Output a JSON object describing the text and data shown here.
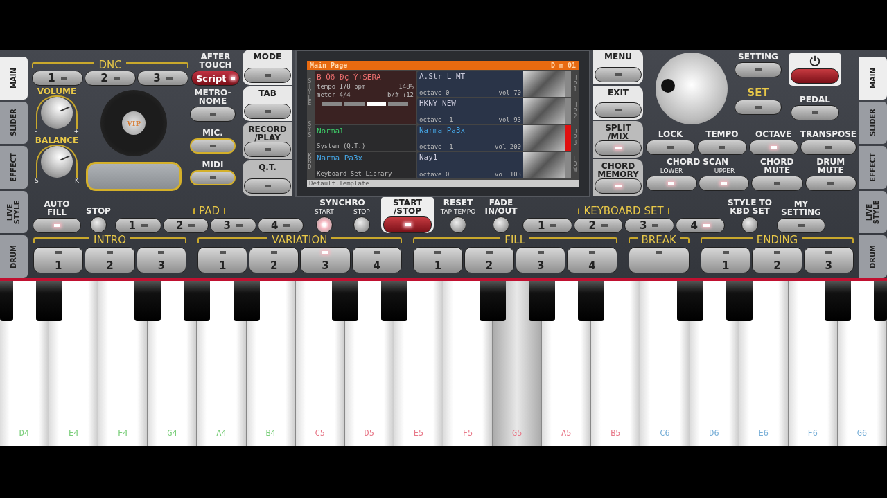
{
  "side_tabs_left": [
    {
      "label": "MAIN",
      "selected": true
    },
    {
      "label": "SLIDER",
      "selected": false
    },
    {
      "label": "EFFECT",
      "selected": false
    },
    {
      "label": "LIVE\nSTYLE",
      "selected": false
    },
    {
      "label": "DRUM",
      "selected": false
    }
  ],
  "side_tabs_right": [
    {
      "label": "MAIN",
      "selected": true
    },
    {
      "label": "SLIDER",
      "selected": false
    },
    {
      "label": "EFFECT",
      "selected": false
    },
    {
      "label": "LIVE\nSTYLE",
      "selected": false
    },
    {
      "label": "DRUM",
      "selected": false
    }
  ],
  "dnc": {
    "title": "DNC",
    "buttons": [
      {
        "label": "1",
        "lit": false
      },
      {
        "label": "2",
        "lit": false
      },
      {
        "label": "3",
        "lit": false
      }
    ]
  },
  "after_touch": {
    "label": "AFTER\nTOUCH",
    "button": {
      "label": "Script",
      "lit": true
    }
  },
  "volume": {
    "label": "VOLUME",
    "min_mark": "-",
    "max_mark": "+"
  },
  "balance": {
    "label": "BALANCE",
    "min_mark": "S",
    "max_mark": "K"
  },
  "vip_disc": {
    "label": "VIP"
  },
  "side_buttons": [
    {
      "label": "METRO-\nNOME",
      "lit": false,
      "framed": false
    },
    {
      "label": "MIC.",
      "lit": false,
      "framed": true
    },
    {
      "label": "MIDI",
      "lit": false,
      "framed": true
    }
  ],
  "mode_buttons": [
    {
      "label": "MODE",
      "lit": false
    },
    {
      "label": "TAB",
      "lit": false
    },
    {
      "label": "RECORD\n/PLAY",
      "lit": false
    },
    {
      "label": "Q.T.",
      "lit": false
    }
  ],
  "display": {
    "title": "Main Page",
    "code": "D m 01",
    "style_tag": "STYLE",
    "sys_tag": "SYS",
    "kbd_tag": "KBD",
    "style_name": "B Ôö Ðç Ý+SERA",
    "tempo": "tempo 178 bpm",
    "tempo_pct": "148%",
    "meter": "meter 4/4",
    "transpose": "b/# +12",
    "bars": [
      {
        "selected": false
      },
      {
        "selected": false
      },
      {
        "selected": true
      },
      {
        "selected": false
      }
    ],
    "sys_name": "Normal",
    "sys_sub": "System (Q.T.)",
    "kbd_name": "Narma Pa3x",
    "kbd_sub": "Keyboard Set Library",
    "footer": "Default.Template",
    "voices": [
      {
        "name": "A.Str L MT",
        "octave": "octave 0",
        "vol": "vol 70",
        "tag": "UP1",
        "selected": false
      },
      {
        "name": "HKNY NEW",
        "octave": "octave -1",
        "vol": "vol 93",
        "tag": "UP2",
        "selected": false
      },
      {
        "name": "Narma Pa3x",
        "octave": "octave -1",
        "vol": "vol 200",
        "tag": "UP3",
        "selected": true
      },
      {
        "name": "Nay1",
        "octave": "octave 0",
        "vol": "vol 103",
        "tag": "LOW",
        "selected": false
      }
    ]
  },
  "right_col_buttons": [
    {
      "label": "MENU",
      "lit": false
    },
    {
      "label": "EXIT",
      "lit": false
    },
    {
      "label": "SPLIT\n/MIX",
      "lit": true
    },
    {
      "label": "CHORD\nMEMORY",
      "lit": true
    }
  ],
  "setting": {
    "label": "SETTING",
    "lit": false
  },
  "set": {
    "label": "SET",
    "lit": false
  },
  "power": {
    "lit": true
  },
  "pedal": {
    "label": "PEDAL",
    "lit": false
  },
  "control_row": [
    {
      "label": "LOCK",
      "lit": false
    },
    {
      "label": "TEMPO",
      "lit": false
    },
    {
      "label": "OCTAVE",
      "lit": true
    },
    {
      "label": "TRANSPOSE",
      "lit": false
    }
  ],
  "chord_scan": {
    "label": "CHORD SCAN",
    "lower": {
      "label": "LOWER",
      "lit": true
    },
    "upper": {
      "label": "UPPER",
      "lit": true
    }
  },
  "mute_buttons": [
    {
      "label": "CHORD\nMUTE",
      "lit": false
    },
    {
      "label": "DRUM\nMUTE",
      "lit": false
    }
  ],
  "auto_fill": {
    "label": "AUTO\nFILL",
    "lit": true
  },
  "pad": {
    "stop": "STOP",
    "title": "PAD",
    "buttons": [
      {
        "label": "1",
        "lit": false
      },
      {
        "label": "2",
        "lit": false
      },
      {
        "label": "3",
        "lit": false
      },
      {
        "label": "4",
        "lit": false
      }
    ]
  },
  "synchro": {
    "title": "SYNCHRO",
    "start": {
      "label": "START",
      "lit": true
    },
    "stop": {
      "label": "STOP",
      "lit": false
    }
  },
  "start_stop": {
    "label": "START\n/STOP",
    "lit": true
  },
  "reset": {
    "label": "RESET",
    "sub": "TAP TEMPO"
  },
  "fade": {
    "label": "FADE\nIN/OUT",
    "lit": false
  },
  "keyboard_set": {
    "title": "KEYBOARD SET",
    "buttons": [
      {
        "label": "1",
        "lit": false
      },
      {
        "label": "2",
        "lit": false
      },
      {
        "label": "3",
        "lit": false
      },
      {
        "label": "4",
        "lit": true
      }
    ]
  },
  "style_to_kbd": {
    "label": "STYLE TO\nKBD SET",
    "lit": false
  },
  "my_setting": {
    "label": "MY\nSETTING",
    "lit": false
  },
  "sections": [
    {
      "title": "INTRO",
      "buttons": [
        {
          "label": "1",
          "lit": false
        },
        {
          "label": "2",
          "lit": false
        },
        {
          "label": "3",
          "lit": false
        }
      ]
    },
    {
      "title": "VARIATION",
      "buttons": [
        {
          "label": "1",
          "lit": false
        },
        {
          "label": "2",
          "lit": false
        },
        {
          "label": "3",
          "lit": true
        },
        {
          "label": "4",
          "lit": false
        }
      ]
    },
    {
      "title": "FILL",
      "buttons": [
        {
          "label": "1",
          "lit": false
        },
        {
          "label": "2",
          "lit": false
        },
        {
          "label": "3",
          "lit": false
        },
        {
          "label": "4",
          "lit": false
        }
      ]
    },
    {
      "title": "BREAK",
      "buttons": [
        {
          "lit": false
        }
      ]
    },
    {
      "title": "ENDING",
      "buttons": [
        {
          "label": "1",
          "lit": false
        },
        {
          "label": "2",
          "lit": false
        },
        {
          "label": "3",
          "lit": false
        }
      ]
    }
  ],
  "keys": [
    {
      "label": "D4",
      "color": "#7ccf7c",
      "pressed": false
    },
    {
      "label": "E4",
      "color": "#7ccf7c",
      "pressed": false
    },
    {
      "label": "F4",
      "color": "#7ccf7c",
      "pressed": false
    },
    {
      "label": "G4",
      "color": "#7ccf7c",
      "pressed": false
    },
    {
      "label": "A4",
      "color": "#7ccf7c",
      "pressed": false
    },
    {
      "label": "B4",
      "color": "#7ccf7c",
      "pressed": false
    },
    {
      "label": "C5",
      "color": "#e87a8a",
      "pressed": false
    },
    {
      "label": "D5",
      "color": "#e87a8a",
      "pressed": false
    },
    {
      "label": "E5",
      "color": "#e87a8a",
      "pressed": false
    },
    {
      "label": "F5",
      "color": "#e87a8a",
      "pressed": false
    },
    {
      "label": "G5",
      "color": "#e87a8a",
      "pressed": true
    },
    {
      "label": "A5",
      "color": "#e87a8a",
      "pressed": false
    },
    {
      "label": "B5",
      "color": "#e87a8a",
      "pressed": false
    },
    {
      "label": "C6",
      "color": "#7ab0d8",
      "pressed": false
    },
    {
      "label": "D6",
      "color": "#7ab0d8",
      "pressed": false
    },
    {
      "label": "E6",
      "color": "#7ab0d8",
      "pressed": false
    },
    {
      "label": "F6",
      "color": "#7ab0d8",
      "pressed": false
    },
    {
      "label": "G6",
      "color": "#7ab0d8",
      "pressed": false
    }
  ]
}
